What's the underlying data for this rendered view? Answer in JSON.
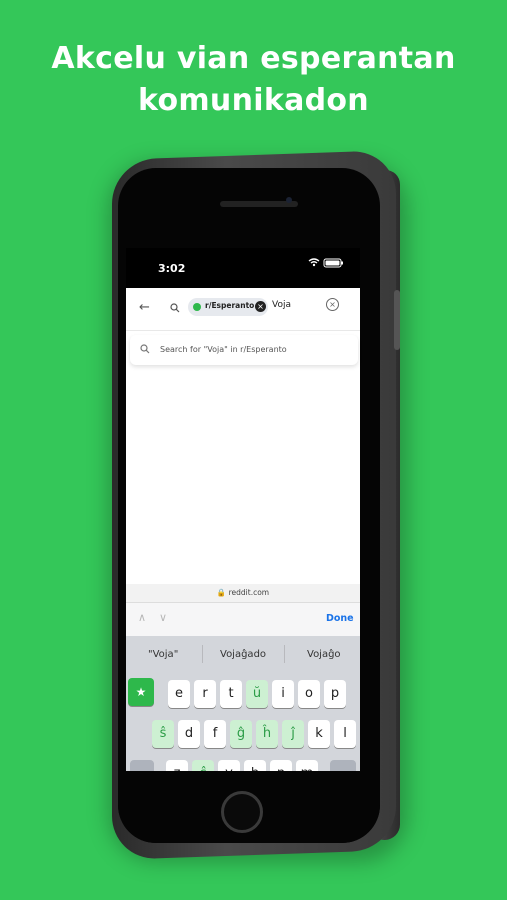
{
  "headline": {
    "line1": "Akcelu vian esperantan",
    "line2": "komunikadon"
  },
  "status": {
    "time": "3:02",
    "icons": "wifi battery"
  },
  "search": {
    "back_icon": "back-arrow-icon",
    "chip_label": "r/Esperanto",
    "query": "Voja",
    "chip_close": "×",
    "clear": "×"
  },
  "suggestion": {
    "text": "Search for \"Voja\" in r/Esperanto"
  },
  "url": {
    "text": "🔒 reddit.com"
  },
  "accessory": {
    "done_label": "Done",
    "up": "∧",
    "down": "∨"
  },
  "predictions": [
    "\"Voja\"",
    "Vojaĝado",
    "Vojaĝo"
  ],
  "keys": {
    "row1": [
      "e",
      "r",
      "t",
      "ŭ",
      "i",
      "o",
      "p"
    ],
    "row2": [
      "ŝ",
      "d",
      "f",
      "ĝ",
      "ĥ",
      "ĵ",
      "k",
      "l"
    ],
    "row3": [
      "z",
      "ĉ",
      "v",
      "b",
      "n",
      "m"
    ],
    "star": "★"
  },
  "colors": {
    "background": "#34c759",
    "accent_green": "#2eb84b",
    "link_blue": "#1a73e8"
  }
}
